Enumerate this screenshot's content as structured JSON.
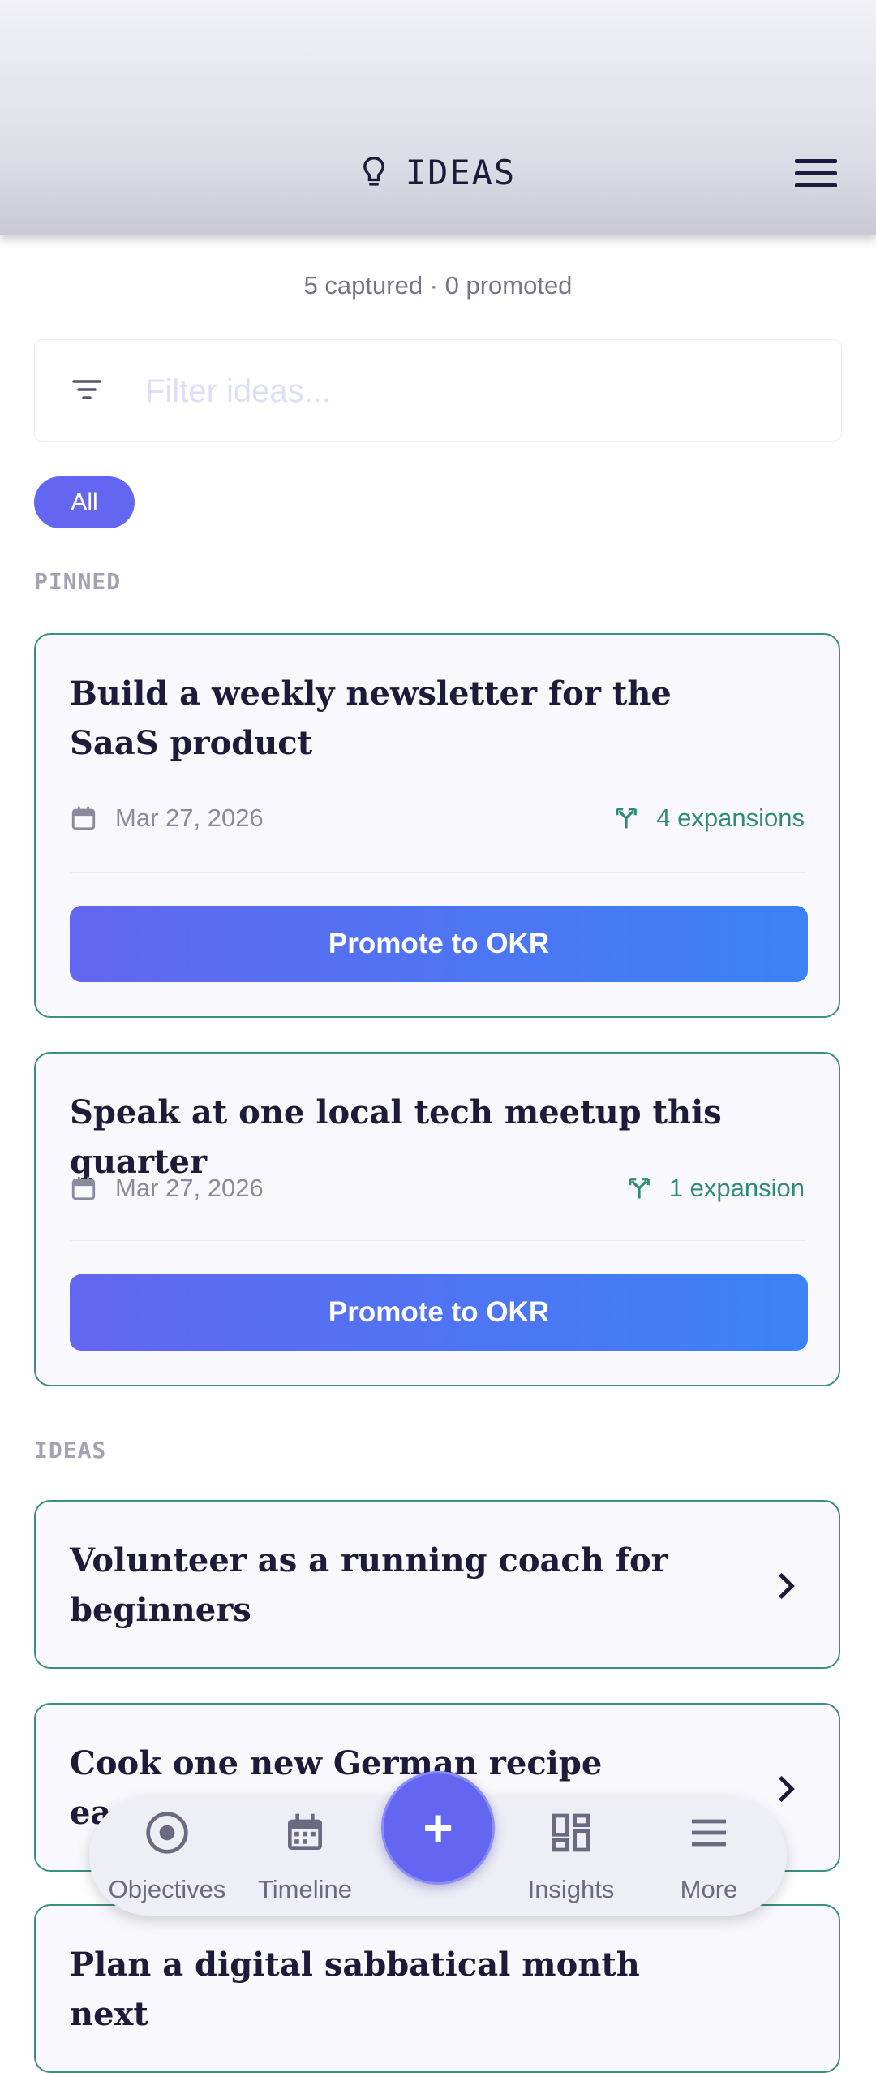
{
  "header": {
    "title": "IDEAS",
    "icon": "lightbulb-icon",
    "menu_icon": "hamburger-menu-icon"
  },
  "summary": "5 captured · 0 promoted",
  "filter": {
    "placeholder": "Filter ideas...",
    "value": ""
  },
  "chips": [
    {
      "label": "All",
      "selected": true
    }
  ],
  "sections": {
    "pinned": "PINNED",
    "ideas": "IDEAS"
  },
  "pinned": [
    {
      "title": "Build a weekly newsletter for the SaaS product",
      "date": "Mar 27, 2026",
      "expansions": "4 expansions",
      "action": "Promote to OKR"
    },
    {
      "title": "Speak at one local tech meetup this quarter",
      "date": "Mar 27, 2026",
      "expansions": "1 expansion",
      "action": "Promote to OKR"
    }
  ],
  "ideas": [
    {
      "title": "Volunteer as a running coach for beginners"
    },
    {
      "title": "Cook one new German recipe each week"
    },
    {
      "title": "Plan a digital sabbatical month next"
    }
  ],
  "nav": [
    {
      "label": "Objectives",
      "icon": "target-icon"
    },
    {
      "label": "Timeline",
      "icon": "calendar-icon"
    },
    {
      "label": "Insights",
      "icon": "dashboard-icon"
    },
    {
      "label": "More",
      "icon": "menu-icon"
    }
  ],
  "fab": {
    "label": "+",
    "icon": "plus-icon"
  },
  "colors": {
    "accent": "#6366f1",
    "accent_end": "#3b82f6",
    "card_border": "#3a8f7e",
    "expansion_text": "#2f8c75"
  }
}
